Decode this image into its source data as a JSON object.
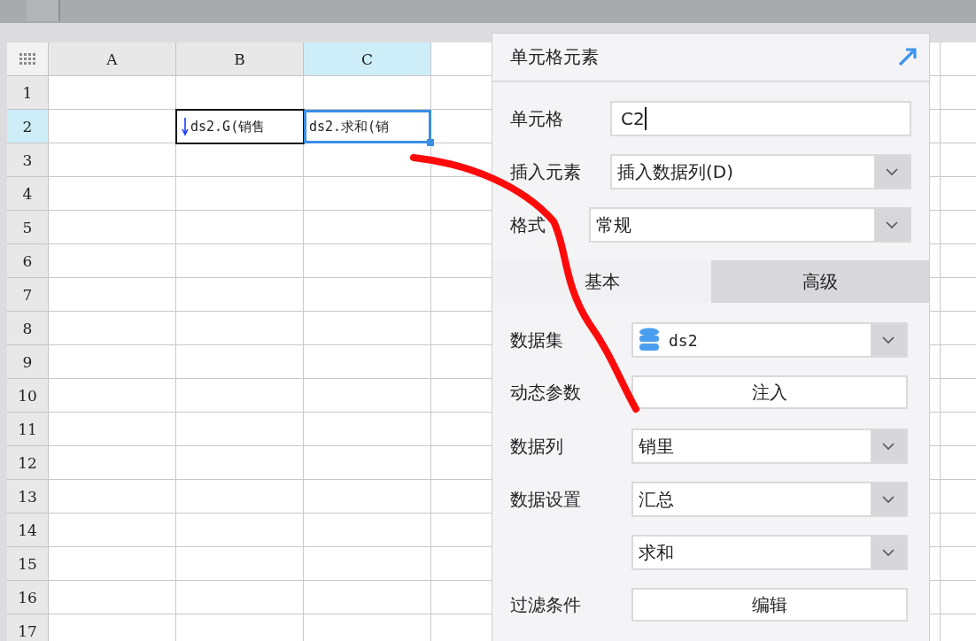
{
  "sheet": {
    "columns": [
      {
        "label": "A",
        "selected": false
      },
      {
        "label": "B",
        "selected": false
      },
      {
        "label": "C",
        "selected": true
      }
    ],
    "rows": [
      {
        "label": "1",
        "selected": false
      },
      {
        "label": "2",
        "selected": true,
        "cells": [
          {
            "text": "ds2.G(销售",
            "selected": false,
            "expand_down": true
          },
          {
            "text": "ds2.求和(销",
            "selected": true,
            "expand_down": false
          }
        ]
      },
      {
        "label": "3",
        "selected": false
      },
      {
        "label": "4",
        "selected": false
      },
      {
        "label": "5",
        "selected": false
      },
      {
        "label": "6",
        "selected": false
      },
      {
        "label": "7",
        "selected": false
      },
      {
        "label": "8",
        "selected": false
      },
      {
        "label": "9",
        "selected": false
      },
      {
        "label": "10",
        "selected": false
      },
      {
        "label": "11",
        "selected": false
      },
      {
        "label": "12",
        "selected": false
      },
      {
        "label": "13",
        "selected": false
      },
      {
        "label": "14",
        "selected": false
      },
      {
        "label": "15",
        "selected": false
      },
      {
        "label": "16",
        "selected": false
      },
      {
        "label": "17",
        "selected": false
      }
    ]
  },
  "panel": {
    "title": "单元格元素",
    "cell_field": {
      "label": "单元格",
      "value": "C2"
    },
    "insert": {
      "label": "插入元素",
      "value": "插入数据列(D)"
    },
    "format": {
      "label": "格式",
      "value": "常规"
    },
    "tabs": [
      {
        "label": "基本",
        "selected": true
      },
      {
        "label": "高级",
        "selected": false
      }
    ],
    "fields": [
      {
        "kind": "dataset",
        "label": "数据集",
        "value": "ds2"
      },
      {
        "kind": "button",
        "label": "动态参数",
        "value": "注入"
      },
      {
        "kind": "select",
        "label": "数据列",
        "value": "销里"
      },
      {
        "kind": "select",
        "label": "数据设置",
        "value": "汇总"
      },
      {
        "kind": "select",
        "value": "求和"
      },
      {
        "kind": "button",
        "label": "过滤条件",
        "value": "编辑"
      }
    ]
  }
}
